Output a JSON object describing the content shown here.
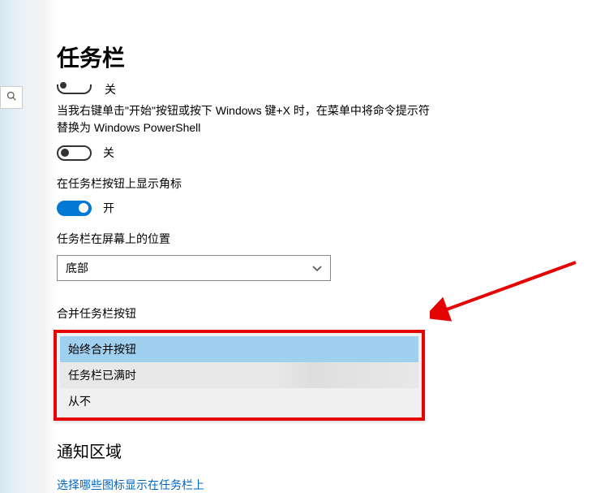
{
  "page": {
    "title": "任务栏"
  },
  "partial_toggle": {
    "label": "关"
  },
  "powershell": {
    "desc": "当我右键单击\"开始\"按钮或按下 Windows 键+X 时，在菜单中将命令提示符替换为 Windows PowerShell",
    "toggle_state": "关"
  },
  "badges": {
    "label": "在任务栏按钮上显示角标",
    "toggle_state": "开"
  },
  "position": {
    "label": "任务栏在屏幕上的位置",
    "selected": "底部"
  },
  "combine": {
    "label": "合并任务栏按钮",
    "options": [
      {
        "label": "始终合并按钮",
        "state": "highlighted"
      },
      {
        "label": "任务栏已满时",
        "state": "mid"
      },
      {
        "label": "从不",
        "state": "plain"
      }
    ]
  },
  "notification": {
    "title": "通知区域",
    "link": "选择哪些图标显示在任务栏上"
  }
}
